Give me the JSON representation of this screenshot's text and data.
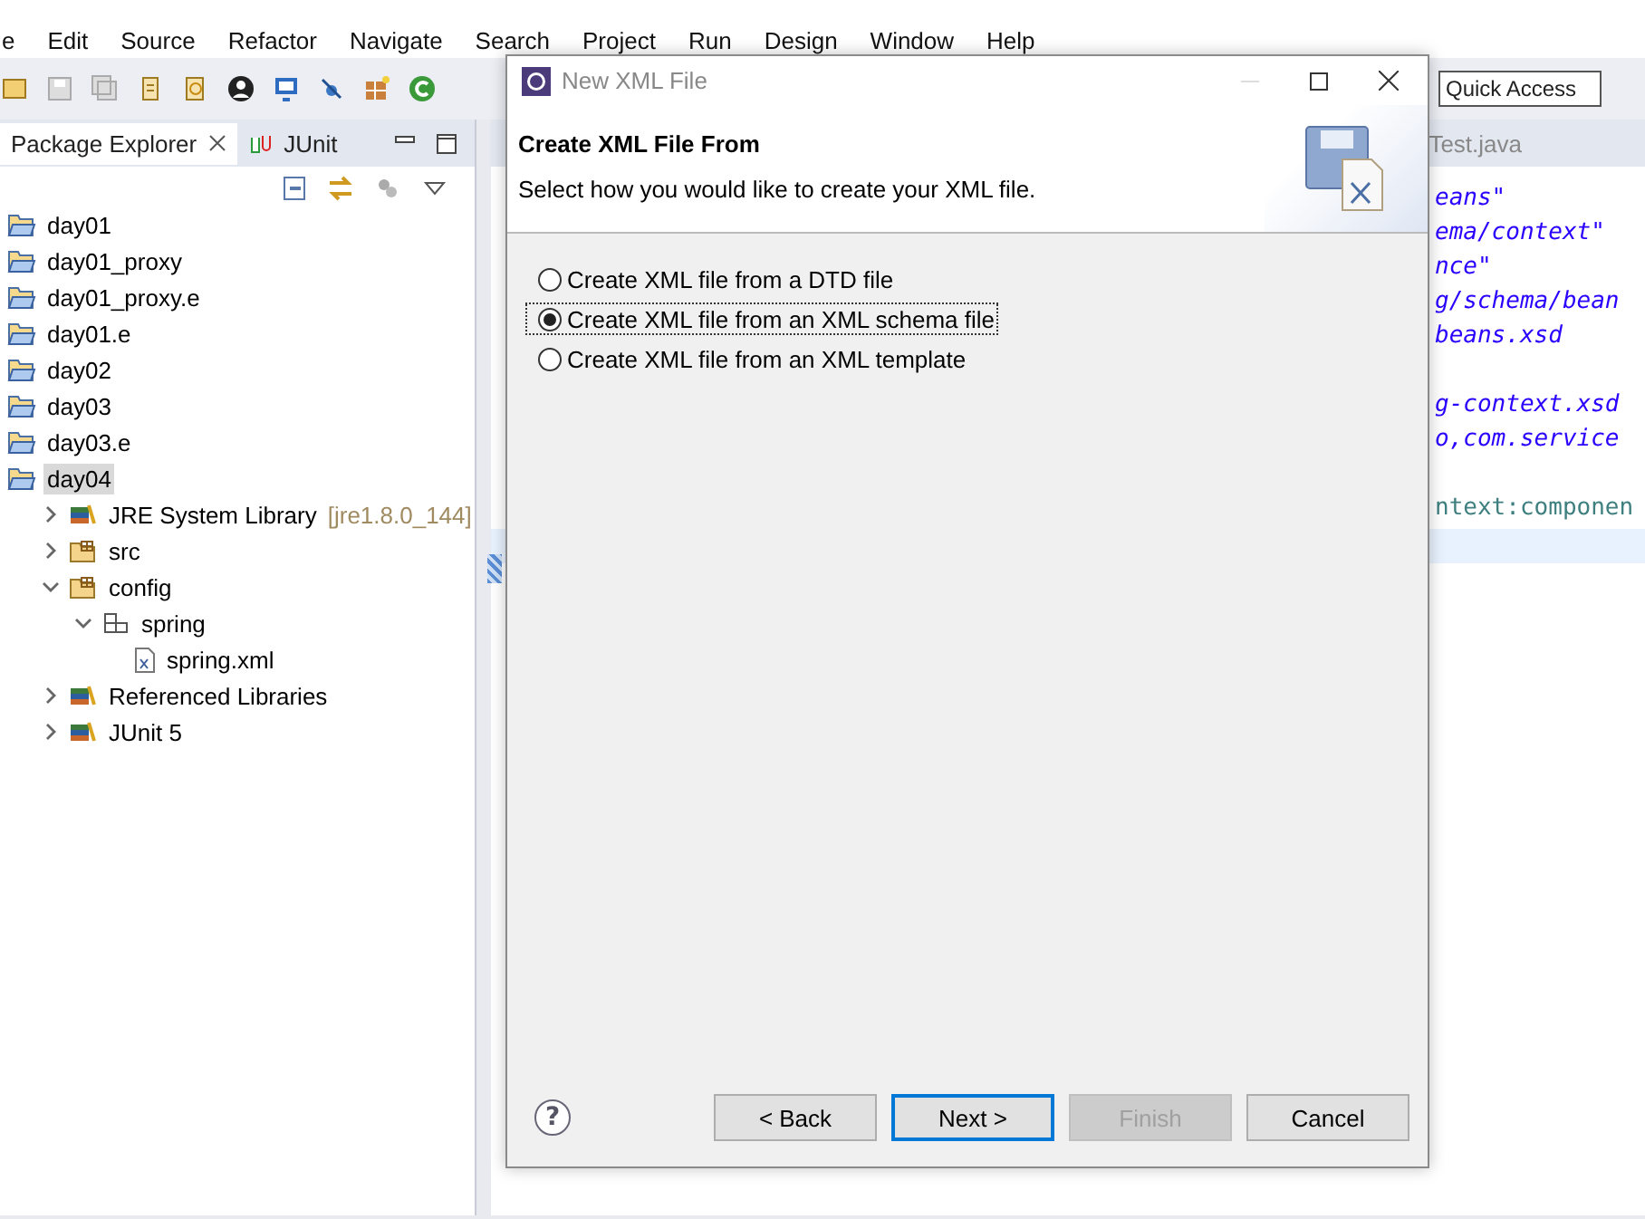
{
  "menu": [
    "e",
    "Edit",
    "Source",
    "Refactor",
    "Navigate",
    "Search",
    "Project",
    "Run",
    "Design",
    "Window",
    "Help"
  ],
  "quick_access": {
    "placeholder": "Quick Access"
  },
  "explorer_tabs": [
    {
      "label": "Package Explorer",
      "selected": true
    },
    {
      "label": "JUnit",
      "selected": false
    }
  ],
  "tree": [
    {
      "label": "day01",
      "kind": "project",
      "selected": false
    },
    {
      "label": "day01_proxy",
      "kind": "project",
      "selected": false
    },
    {
      "label": "day01_proxy.e",
      "kind": "project",
      "selected": false
    },
    {
      "label": "day01.e",
      "kind": "project",
      "selected": false
    },
    {
      "label": "day02",
      "kind": "project",
      "selected": false
    },
    {
      "label": "day03",
      "kind": "project",
      "selected": false
    },
    {
      "label": "day03.e",
      "kind": "project",
      "selected": false
    },
    {
      "label": "day04",
      "kind": "project",
      "selected": true,
      "children": [
        {
          "label": "JRE System Library",
          "detail": "[jre1.8.0_144]",
          "kind": "library",
          "selected": false,
          "expanded": false
        },
        {
          "label": "src",
          "kind": "source-folder",
          "selected": false,
          "expanded": false
        },
        {
          "label": "config",
          "kind": "source-folder",
          "selected": false,
          "expanded": true,
          "children": [
            {
              "label": "spring",
              "kind": "package",
              "selected": false,
              "expanded": true,
              "children": [
                {
                  "label": "spring.xml",
                  "kind": "xml-file",
                  "selected": false
                }
              ]
            }
          ]
        },
        {
          "label": "Referenced Libraries",
          "kind": "library",
          "selected": false,
          "expanded": false
        },
        {
          "label": "JUnit 5",
          "kind": "library",
          "selected": false,
          "expanded": false
        }
      ]
    }
  ],
  "editor": {
    "tab": "Test.java",
    "lines": [
      {
        "text": "eans\"",
        "kind": "string"
      },
      {
        "text": "ema/context\"",
        "kind": "string"
      },
      {
        "text": "nce\"",
        "kind": "string"
      },
      {
        "text": "g/schema/bean",
        "kind": "string"
      },
      {
        "text": "beans.xsd",
        "kind": "string"
      },
      {
        "kind": "blank"
      },
      {
        "text": "g-context.xsd",
        "kind": "string"
      },
      {
        "text": "o,com.service",
        "kind": "string"
      },
      {
        "kind": "blank"
      },
      {
        "text": "ntext:componen",
        "kind": "tag"
      },
      {
        "kind": "current"
      }
    ]
  },
  "dialog": {
    "title": "New XML File",
    "heading": "Create XML File From",
    "description": "Select how you would like to create your XML file.",
    "options": [
      {
        "label": "Create XML file from a DTD file",
        "selected": false
      },
      {
        "label": "Create XML file from an XML schema file",
        "selected": true
      },
      {
        "label": "Create XML file from an XML template",
        "selected": false
      }
    ],
    "help": "?",
    "buttons": [
      {
        "label": "< Back",
        "disabled": false,
        "default": false
      },
      {
        "label": "Next >",
        "disabled": false,
        "default": true
      },
      {
        "label": "Finish",
        "disabled": true,
        "default": false
      },
      {
        "label": "Cancel",
        "disabled": false,
        "default": false
      }
    ]
  }
}
